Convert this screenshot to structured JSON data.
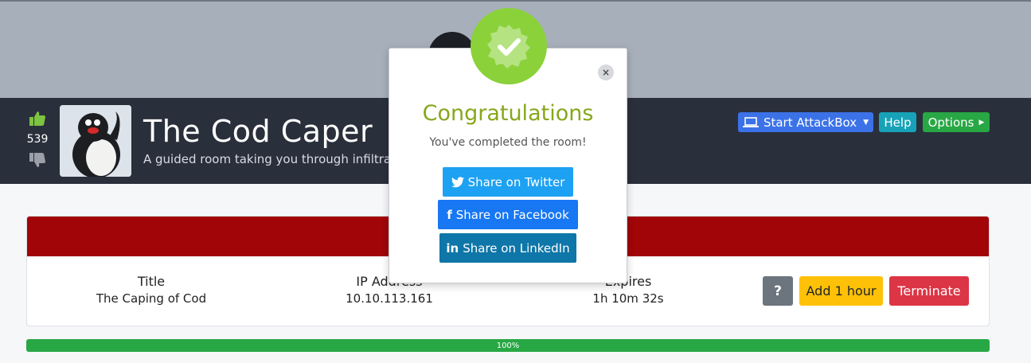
{
  "room": {
    "title": "The Cod Caper",
    "description": "A guided room taking you through infiltrat",
    "votes": "539"
  },
  "toolbar": {
    "attackbox_label": "Start AttackBox",
    "help_label": "Help",
    "options_label": "Options"
  },
  "machine": {
    "title_label": "Title",
    "title_value": "The Caping of Cod",
    "ip_label": "IP Address",
    "ip_value": "10.10.113.161",
    "expires_label": "Expires",
    "expires_value": "1h 10m 32s",
    "help_label": "?",
    "add_hour_label": "Add 1 hour",
    "terminate_label": "Terminate"
  },
  "progress": {
    "label": "100%",
    "value": 100
  },
  "modal": {
    "title": "Congratulations",
    "subtitle": "You've completed the room!",
    "close_label": "×",
    "share_twitter": "Share on Twitter",
    "share_facebook": "Share on Facebook",
    "share_linkedin": "Share on LinkedIn"
  },
  "colors": {
    "header_bg": "#2a2f3c",
    "accent_green": "#8bd13a",
    "title_green": "#87a71c",
    "card_head_red": "#a10508"
  }
}
